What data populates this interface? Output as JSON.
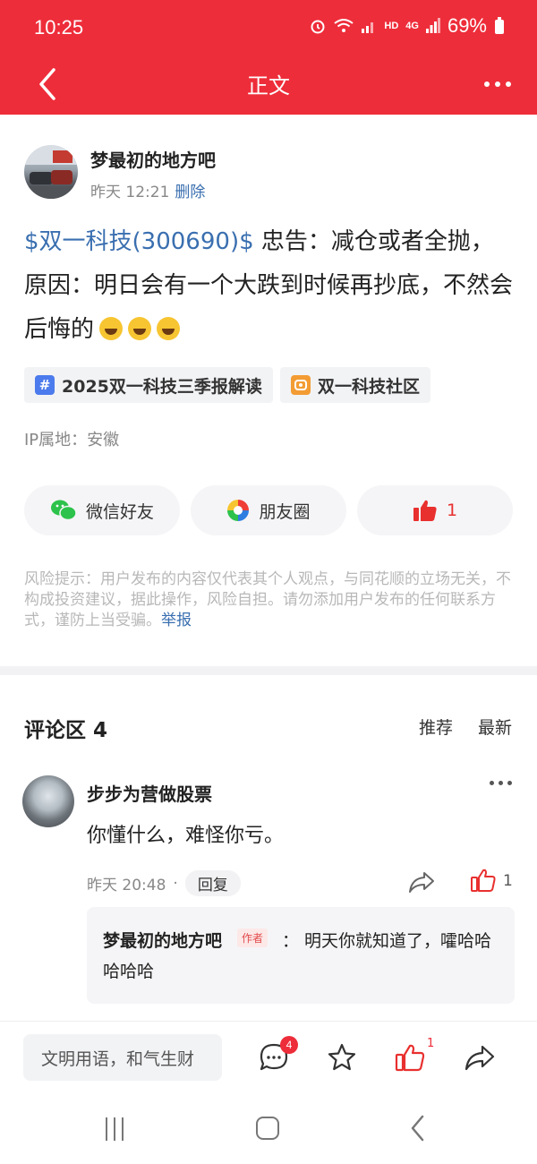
{
  "status_bar": {
    "time": "10:25",
    "battery": "69%",
    "hd": "HD",
    "net": "4G"
  },
  "nav": {
    "title": "正文"
  },
  "post": {
    "author": "梦最初的地方吧",
    "time": "昨天 12:21",
    "delete_label": "删除",
    "stock_link": "$双一科技(300690)$",
    "body": " 忠告：减仓或者全抛，原因：明日会有一个大跌到时候再抄底，不然会后悔的",
    "tags": [
      {
        "icon": "#",
        "label": "2025双一科技三季报解读"
      },
      {
        "label": "双一科技社区"
      }
    ],
    "ip_location": "IP属地：安徽"
  },
  "share": {
    "wechat": "微信好友",
    "moments": "朋友圈",
    "like_count": "1"
  },
  "risk": {
    "text": "风险提示：用户发布的内容仅代表其个人观点，与同花顺的立场无关，不构成投资建议，据此操作，风险自担。请勿添加用户发布的任何联系方式，谨防上当受骗。",
    "report": "举报"
  },
  "comments": {
    "title": "评论区 4",
    "sort_recommend": "推荐",
    "sort_latest": "最新",
    "items": [
      {
        "author": "步步为营做股票",
        "text": "你懂什么，难怪你亏。",
        "time": "昨天 20:48",
        "dot": "·",
        "reply_label": "回复",
        "like_count": "1",
        "reply": {
          "author": "梦最初的地方吧",
          "badge": "作者",
          "text": "：  明天你就知道了，嚯哈哈哈哈哈"
        }
      }
    ]
  },
  "bottom_bar": {
    "input_placeholder": "文明用语，和气生财",
    "comment_count": "4",
    "like_count": "1"
  },
  "colors": {
    "brand_red": "#ee2d3a",
    "link_blue": "#3a6fb0"
  }
}
